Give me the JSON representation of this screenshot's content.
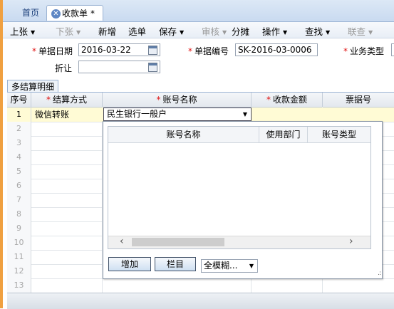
{
  "tabs": {
    "home": "首页",
    "receipt": "收款单",
    "receipt_marker": "*"
  },
  "toolbar": {
    "prev": "上张",
    "next": "下张",
    "add": "新增",
    "select": "选单",
    "save": "保存",
    "approve": "审核",
    "split": "分摊",
    "operate": "操作",
    "find": "查找",
    "link": "联查"
  },
  "form": {
    "date_label": "单据日期",
    "date_value": "2016-03-22",
    "number_label": "单据编号",
    "number_value": "SK-2016-03-0006",
    "biztype_label": "业务类型",
    "discount_label": "折让",
    "discount_value": ""
  },
  "detail_tab": "多结算明细",
  "grid": {
    "columns": {
      "seq": "序号",
      "method": "结算方式",
      "account": "账号名称",
      "amount": "收款金额",
      "bill": "票据号"
    },
    "rows": [
      {
        "seq": "1",
        "method": "微信转账",
        "account": "民生银行一般户"
      },
      {
        "seq": "2"
      },
      {
        "seq": "3"
      },
      {
        "seq": "4"
      },
      {
        "seq": "5"
      },
      {
        "seq": "6"
      },
      {
        "seq": "7"
      },
      {
        "seq": "8"
      },
      {
        "seq": "9"
      },
      {
        "seq": "10"
      },
      {
        "seq": "11"
      },
      {
        "seq": "12"
      },
      {
        "seq": "13"
      }
    ]
  },
  "popup": {
    "columns": {
      "name": "账号名称",
      "dept": "使用部门",
      "type": "账号类型"
    },
    "add_button": "增加",
    "columns_button": "栏目",
    "fuzzy_value": "全模糊..."
  }
}
